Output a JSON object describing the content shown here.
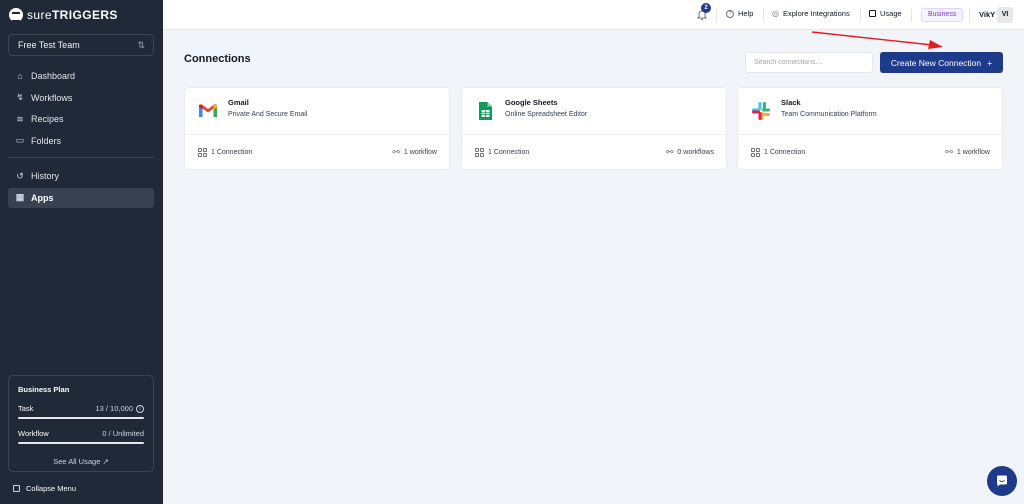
{
  "brand": {
    "logo_text_a": "sure",
    "logo_text_b": "TRIGGERS"
  },
  "sidebar": {
    "team": "Free Test Team",
    "nav_primary": [
      {
        "label": "Dashboard",
        "icon": "home-icon"
      },
      {
        "label": "Workflows",
        "icon": "workflow-icon"
      },
      {
        "label": "Recipes",
        "icon": "recipes-icon"
      },
      {
        "label": "Folders",
        "icon": "folder-icon"
      }
    ],
    "nav_secondary": [
      {
        "label": "History",
        "icon": "history-icon"
      },
      {
        "label": "Apps",
        "icon": "apps-icon",
        "active": true
      }
    ],
    "plan": {
      "title": "Business Plan",
      "task_label": "Task",
      "task_value": "13 / 10,000",
      "task_used_fraction": 0.0013,
      "workflow_label": "Workflow",
      "workflow_value": "0 / Unlimited",
      "see_all": "See All Usage ↗"
    },
    "collapse": "Collapse Menu"
  },
  "topbar": {
    "notification_count": "2",
    "help": "Help",
    "explore": "Explore Integrations",
    "usage": "Usage",
    "plan_badge": "Business",
    "user_name": "VikY",
    "avatar_initials": "VI"
  },
  "main": {
    "title": "Connections",
    "search_placeholder": "Search connections...",
    "create_button": "Create New Connection",
    "create_button_icon": "+"
  },
  "connections": [
    {
      "name": "Gmail",
      "desc": "Private And Secure Email",
      "connections": "1 Connection",
      "workflows": "1 workflow",
      "icon": "gmail-icon"
    },
    {
      "name": "Google Sheets",
      "desc": "Online Spreadsheet Editor",
      "connections": "1 Connection",
      "workflows": "0 workflows",
      "icon": "google-sheets-icon"
    },
    {
      "name": "Slack",
      "desc": "Team Communication Platform",
      "connections": "1 Connection",
      "workflows": "1 workflow",
      "icon": "slack-icon"
    }
  ],
  "colors": {
    "sidebar_bg": "#1f2937",
    "accent": "#1e3a8a",
    "annotation_arrow": "#e11d1d",
    "plan_badge": "#7c3aed"
  }
}
